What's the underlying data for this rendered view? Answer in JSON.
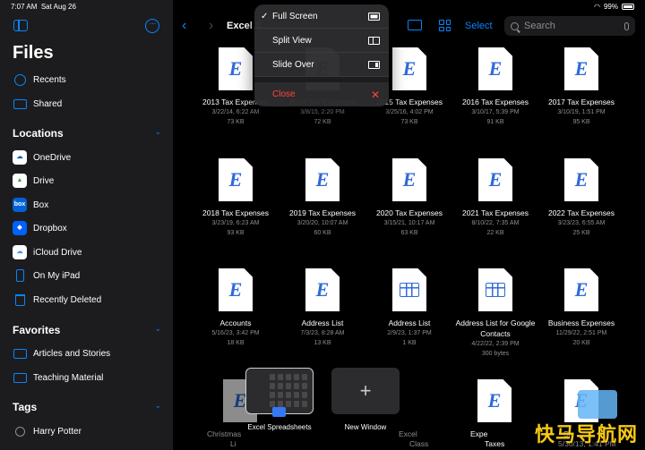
{
  "status": {
    "time": "7:07 AM",
    "date": "Sat Aug 26",
    "battery": "99%"
  },
  "sidebar": {
    "title": "Files",
    "top_items": [
      {
        "label": "Recents",
        "icon": "clock-icon"
      },
      {
        "label": "Shared",
        "icon": "shared-folder-icon"
      }
    ],
    "locations_header": "Locations",
    "locations": [
      {
        "label": "OneDrive",
        "icon": "onedrive-icon"
      },
      {
        "label": "Drive",
        "icon": "google-drive-icon"
      },
      {
        "label": "Box",
        "icon": "box-icon",
        "icon_text": "box"
      },
      {
        "label": "Dropbox",
        "icon": "dropbox-icon"
      },
      {
        "label": "iCloud Drive",
        "icon": "icloud-icon"
      },
      {
        "label": "On My iPad",
        "icon": "ipad-icon"
      },
      {
        "label": "Recently Deleted",
        "icon": "trash-icon"
      }
    ],
    "favorites_header": "Favorites",
    "favorites": [
      {
        "label": "Articles and Stories",
        "icon": "folder-icon"
      },
      {
        "label": "Teaching Material",
        "icon": "folder-icon"
      }
    ],
    "tags_header": "Tags",
    "tags": [
      {
        "label": "Harry Potter",
        "icon": "tag-circle-icon"
      }
    ]
  },
  "toolbar": {
    "title": "Excel S",
    "select_label": "Select",
    "search_placeholder": "Search"
  },
  "menu": {
    "items": [
      {
        "label": "Full Screen",
        "checked": true,
        "icon": "full-screen-icon"
      },
      {
        "label": "Split View",
        "checked": false,
        "icon": "split-view-icon"
      },
      {
        "label": "Slide Over",
        "checked": false,
        "icon": "slide-over-icon"
      }
    ],
    "close_label": "Close",
    "checkmark": "✓"
  },
  "files": [
    {
      "name": "2013 Tax Expenses",
      "date": "3/22/14, 6:22 AM",
      "size": "73 KB",
      "type": "excel"
    },
    {
      "name": "2014 Tax Expenses",
      "date": "3/8/15, 2:20 PM",
      "size": "72 KB",
      "type": "excel"
    },
    {
      "name": "2015 Tax Expenses",
      "date": "3/25/16, 4:02 PM",
      "size": "73 KB",
      "type": "excel"
    },
    {
      "name": "2016 Tax Expenses",
      "date": "3/10/17, 5:39 PM",
      "size": "91 KB",
      "type": "excel"
    },
    {
      "name": "2017 Tax Expenses",
      "date": "3/10/19, 1:51 PM",
      "size": "95 KB",
      "type": "excel"
    },
    {
      "name": "2018 Tax Expenses",
      "date": "3/23/19, 6:23 AM",
      "size": "93 KB",
      "type": "excel"
    },
    {
      "name": "2019 Tax Expenses",
      "date": "3/20/20, 10:07 AM",
      "size": "60 KB",
      "type": "excel"
    },
    {
      "name": "2020 Tax Expenses",
      "date": "3/15/21, 10:17 AM",
      "size": "63 KB",
      "type": "excel"
    },
    {
      "name": "2021 Tax Expenses",
      "date": "8/10/22, 7:35 AM",
      "size": "22 KB",
      "type": "excel"
    },
    {
      "name": "2022 Tax Expenses",
      "date": "3/23/23, 6:55 AM",
      "size": "25 KB",
      "type": "excel"
    },
    {
      "name": "Accounts",
      "date": "5/16/23, 3:42 PM",
      "size": "18 KB",
      "type": "excel"
    },
    {
      "name": "Address List",
      "date": "7/3/23, 8:28 AM",
      "size": "13 KB",
      "type": "excel"
    },
    {
      "name": "Address List",
      "date": "2/9/23, 1:37 PM",
      "size": "1 KB",
      "type": "numbers"
    },
    {
      "name": "Address List for Google Contacts",
      "date": "4/22/22, 2:39 PM",
      "size": "300 bytes",
      "type": "numbers"
    },
    {
      "name": "Business Expenses",
      "date": "11/29/22, 2:51 PM",
      "size": "20 KB",
      "type": "excel"
    }
  ],
  "bottom_row": {
    "partial_labels": [
      "Christmas",
      "Li",
      "Excel",
      "Class",
      "Expe",
      "Taxes",
      "Sh",
      "5/30/13, 1:41 PM"
    ]
  },
  "shelf": {
    "window_label": "Excel Spreadsheets",
    "new_window_label": "New Window",
    "plus": "+"
  },
  "excel_glyph": "E",
  "watermark": "快马导航网",
  "colors": {
    "accent": "#0a84ff",
    "danger": "#ff453a",
    "sidebar_bg": "#1c1c1e",
    "excel_blue": "#2f6ad9"
  }
}
